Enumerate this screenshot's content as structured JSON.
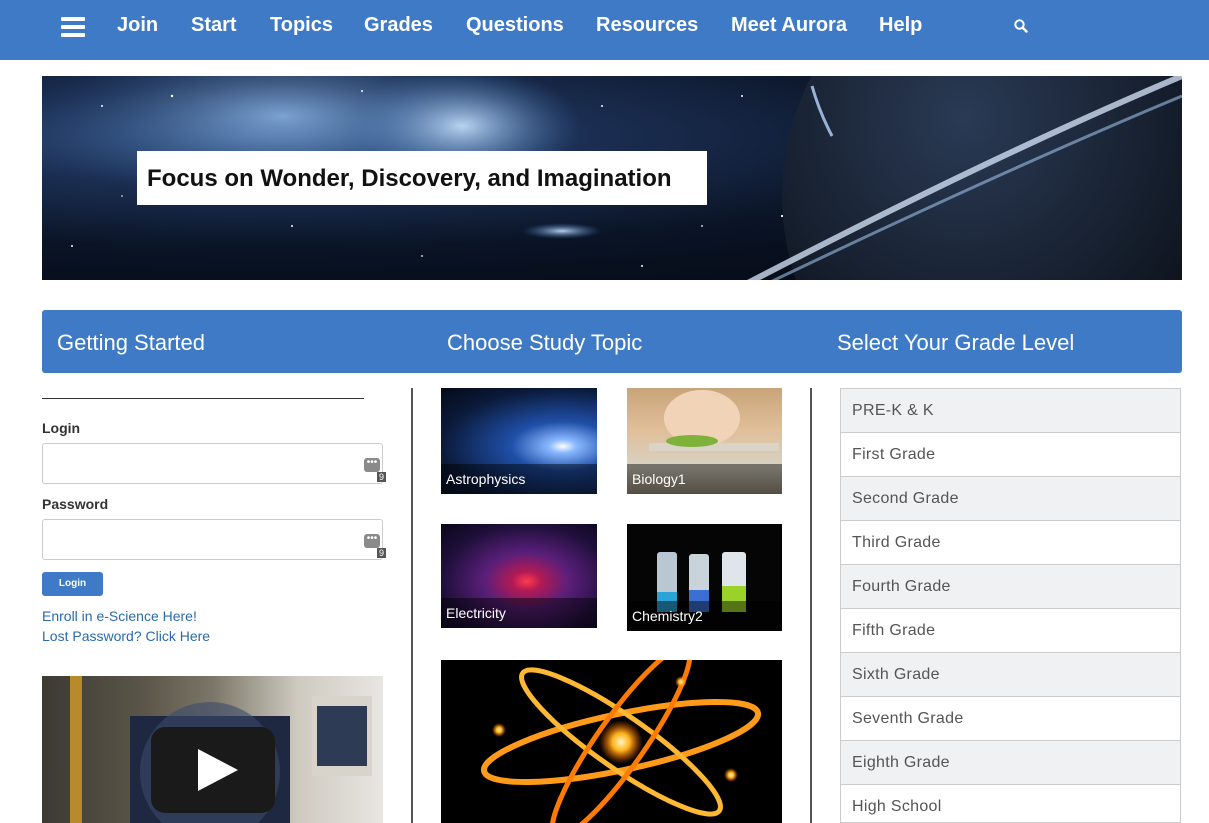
{
  "nav": {
    "items": [
      "Join",
      "Start",
      "Topics",
      "Grades",
      "Questions",
      "Resources",
      "Meet Aurora",
      "Help"
    ],
    "menu_icon": "hamburger-menu-icon",
    "search_icon": "search-icon"
  },
  "hero": {
    "title": "Focus on Wonder, Discovery, and Imagination"
  },
  "sections": {
    "getting_started": "Getting Started",
    "study_topic": "Choose Study Topic",
    "grade_level": "Select Your Grade Level"
  },
  "login": {
    "login_label": "Login",
    "password_label": "Password",
    "badge_count": "9",
    "button_label": "Login",
    "enroll_link": "Enroll in e-Science Here!",
    "lost_password_link": "Lost Password? Click Here"
  },
  "topics": [
    "Astrophysics",
    "Biology1",
    "Electricity",
    "Chemistry2"
  ],
  "grades": [
    "PRE-K & K",
    "First Grade",
    "Second Grade",
    "Third Grade",
    "Fourth Grade",
    "Fifth Grade",
    "Sixth Grade",
    "Seventh Grade",
    "Eighth Grade",
    "High School"
  ],
  "colors": {
    "brand_blue": "#3e7ac6",
    "link_blue": "#2a6aad"
  }
}
